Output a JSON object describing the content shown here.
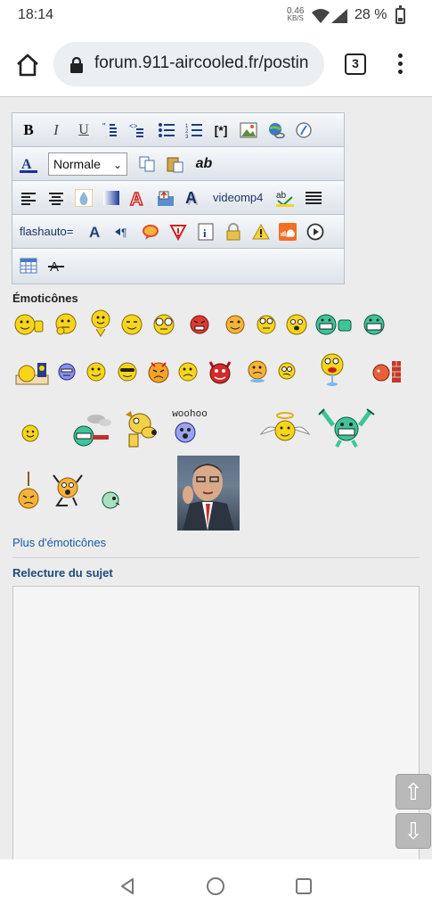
{
  "status_bar": {
    "time": "18:14",
    "net_speed_value": "0.46",
    "net_speed_unit": "KB/S",
    "battery": "28 %",
    "battery_level": 0.28
  },
  "browser": {
    "url": "forum.911-aircooled.fr/postin",
    "tab_count": "3"
  },
  "editor": {
    "font_size_selected": "Normale",
    "videomp4_label": "videomp4",
    "flashauto_label": "flashauto=",
    "ab_label": "ab"
  },
  "smileys_section": {
    "title": "Émoticônes",
    "more_link": "Plus d'émoticônes"
  },
  "review": {
    "title": "Relecture du sujet"
  },
  "scroll": {
    "up": "⇧",
    "down": "⇩"
  },
  "colors": {
    "accent_link": "#1a5aa0",
    "smiley_yellow": "#f7d51d",
    "smiley_green": "#3fc49a"
  },
  "icons": [
    "home-icon",
    "lock-icon",
    "tabs-icon",
    "menu-icon",
    "back-icon",
    "home-circle-icon",
    "recents-icon"
  ]
}
